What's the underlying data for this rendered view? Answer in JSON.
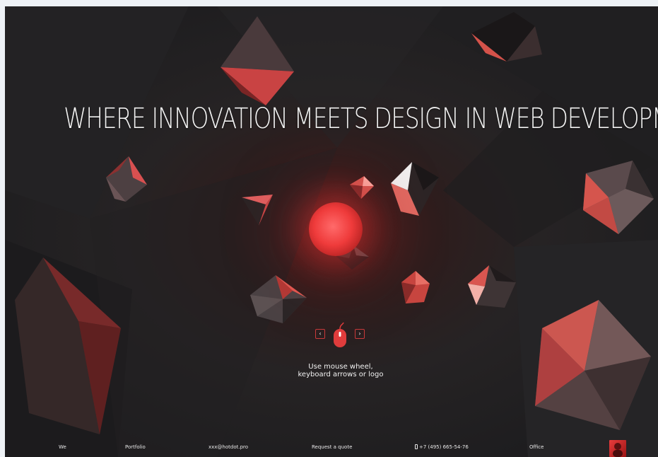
{
  "hero": {
    "headline": "WHERE INNOVATION MEETS DESIGN IN WEB DEVELOPMENT",
    "hint_line1": "Use mouse wheel,",
    "hint_line2": "keyboard arrows or logo",
    "prev_arrow": "‹",
    "next_arrow": "›"
  },
  "footer": {
    "items": [
      {
        "label": "We"
      },
      {
        "label": "Portfolio"
      },
      {
        "label": "xxx@hotdot.pro"
      },
      {
        "label": "Request a quote"
      },
      {
        "label": "+7 (495) 665-54-76"
      },
      {
        "label": "Office"
      }
    ]
  },
  "colors": {
    "accent": "#e83c3c",
    "background": "#1f1e20",
    "text": "#f0f0f0"
  },
  "icons": [
    "mouse-icon",
    "chevron-left-icon",
    "chevron-right-icon",
    "phone-icon",
    "avatar"
  ]
}
